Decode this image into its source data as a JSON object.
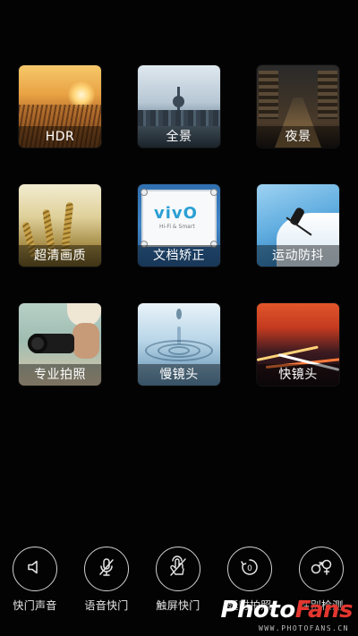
{
  "modes": [
    {
      "id": "hdr",
      "label": "HDR"
    },
    {
      "id": "panorama",
      "label": "全景"
    },
    {
      "id": "night",
      "label": "夜景"
    },
    {
      "id": "ultra_hd",
      "label": "超清画质"
    },
    {
      "id": "doc_correct",
      "label": "文档矫正"
    },
    {
      "id": "anti_shake",
      "label": "运动防抖"
    },
    {
      "id": "pro",
      "label": "专业拍照"
    },
    {
      "id": "slow_motion",
      "label": "慢镜头"
    },
    {
      "id": "fast_motion",
      "label": "快镜头"
    }
  ],
  "doc_tile": {
    "logo": "vivO",
    "subtitle": "Hi-Fi & Smart"
  },
  "toolbar": [
    {
      "id": "shutter_sound",
      "label": "快门声音",
      "icon": "speaker-icon"
    },
    {
      "id": "voice_shutter",
      "label": "语音快门",
      "icon": "microphone-off-icon"
    },
    {
      "id": "touch_shutter",
      "label": "触屏快门",
      "icon": "touch-off-icon"
    },
    {
      "id": "timer",
      "label": "延时拍照",
      "icon": "timer-icon"
    },
    {
      "id": "gender_detect",
      "label": "性别检测",
      "icon": "gender-icon"
    }
  ],
  "watermark": {
    "brand_a": "Photo",
    "brand_b": "Fans",
    "url": "WWW.PHOTOFANS.CN"
  },
  "colors": {
    "background": "#030303",
    "accent": "#e2362f"
  }
}
